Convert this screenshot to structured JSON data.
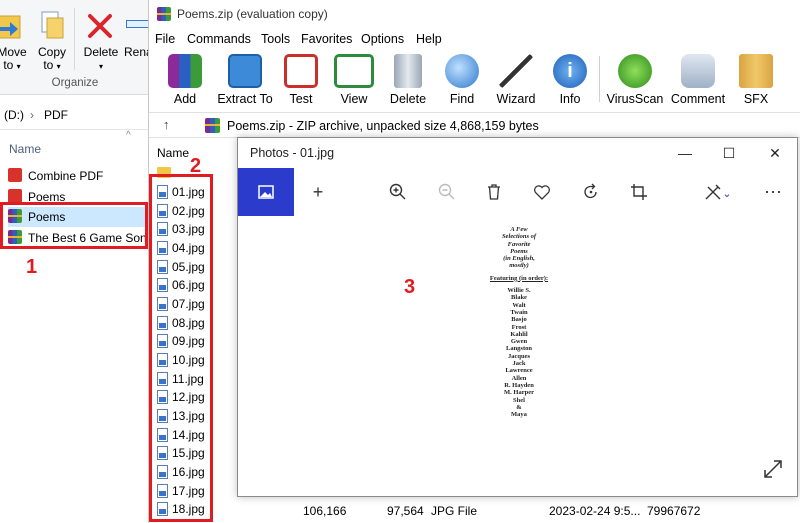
{
  "explorer": {
    "ribbon": {
      "move_to": "Move\nto",
      "copy_to": "Copy\nto",
      "delete": "Delete",
      "rename": "Rena",
      "group": "Organize",
      "move_to_l1": "Move",
      "move_to_l2": "to",
      "copy_to_l1": "Copy",
      "copy_to_l2": "to"
    },
    "address": {
      "drive": "(D:)",
      "sep": "›",
      "folder": "PDF"
    },
    "column_name": "Name",
    "items": [
      {
        "label": "Combine PDF"
      },
      {
        "label": "Poems"
      },
      {
        "label": "Poems"
      },
      {
        "label": "The Best 6 Game Sonc"
      }
    ]
  },
  "winrar": {
    "title": "Poems.zip (evaluation copy)",
    "menu": [
      "File",
      "Commands",
      "Tools",
      "Favorites",
      "Options",
      "Help"
    ],
    "toolbar": [
      {
        "label": "Add",
        "icon": "add-archive-icon"
      },
      {
        "label": "Extract To",
        "icon": "extract-folder-icon"
      },
      {
        "label": "Test",
        "icon": "test-clipboard-icon"
      },
      {
        "label": "View",
        "icon": "view-book-icon"
      },
      {
        "label": "Delete",
        "icon": "trash-icon"
      },
      {
        "label": "Find",
        "icon": "magnifier-icon"
      },
      {
        "label": "Wizard",
        "icon": "wand-icon"
      },
      {
        "label": "Info",
        "icon": "info-icon"
      },
      {
        "label": "VirusScan",
        "icon": "bug-icon"
      },
      {
        "label": "Comment",
        "icon": "comment-icon"
      },
      {
        "label": "SFX",
        "icon": "sfx-box-icon"
      }
    ],
    "path": "Poems.zip - ZIP archive, unpacked size 4,868,159 bytes",
    "column_name": "Name",
    "parent": "..",
    "files": [
      "01.jpg",
      "02.jpg",
      "03.jpg",
      "04.jpg",
      "05.jpg",
      "06.jpg",
      "07.jpg",
      "08.jpg",
      "09.jpg",
      "10.jpg",
      "11.jpg",
      "12.jpg",
      "13.jpg",
      "14.jpg",
      "15.jpg",
      "16.jpg",
      "17.jpg",
      "18.jpg"
    ],
    "status": {
      "size": "106,166",
      "packed": "97,564",
      "type": "JPG File",
      "modified": "2023-02-24 9:5...",
      "crc": "79967672"
    }
  },
  "annotations": [
    "1",
    "2",
    "3"
  ],
  "photos": {
    "title": "Photos - 01.jpg",
    "controls": {
      "minimize": "—",
      "maximize": "☐",
      "close": "✕"
    },
    "document": {
      "lines": [
        "A Few",
        "Selections of",
        "Favorite",
        "Poems",
        "(in English,",
        "mostly)"
      ],
      "featuring": "Featuring (in order):",
      "names": [
        "Willie S.",
        "Blake",
        "Walt",
        "Twain",
        "Basjo",
        "Frost",
        "Kahlil",
        "Gwen",
        "Langston",
        "Jacques",
        "Jack",
        "Lawrence",
        "Allen",
        "R. Hayden",
        "M. Harper",
        "Shel",
        "&",
        "Maya"
      ]
    }
  },
  "colors": {
    "annotation_red": "#e11b22",
    "photos_accent": "#2b3bcc",
    "selection": "#cce8ff"
  }
}
